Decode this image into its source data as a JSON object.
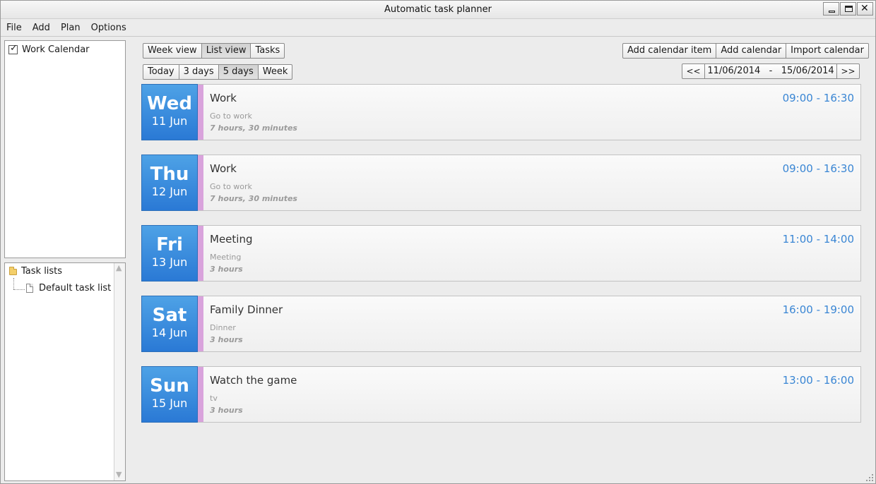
{
  "window": {
    "title": "Automatic task planner"
  },
  "menu": [
    "File",
    "Add",
    "Plan",
    "Options"
  ],
  "calendars": [
    {
      "name": "Work Calendar",
      "checked": true
    }
  ],
  "task_tree": {
    "root": "Task lists",
    "children": [
      "Default task list"
    ]
  },
  "view_tabs": {
    "items": [
      "Week view",
      "List view",
      "Tasks"
    ],
    "selected": "List view"
  },
  "range_tabs": {
    "items": [
      "Today",
      "3 days",
      "5 days",
      "Week"
    ],
    "selected": "5 days"
  },
  "actions": [
    "Add calendar item",
    "Add calendar",
    "Import calendar"
  ],
  "date_range": {
    "prev": "<<",
    "next": ">>",
    "text": "11/06/2014   -   15/06/2014"
  },
  "events": [
    {
      "day": "Wed",
      "date": "11 Jun",
      "title": "Work",
      "description": "Go to work",
      "duration": "7 hours, 30 minutes",
      "time": "09:00 - 16:30"
    },
    {
      "day": "Thu",
      "date": "12 Jun",
      "title": "Work",
      "description": "Go to work",
      "duration": "7 hours, 30 minutes",
      "time": "09:00 - 16:30"
    },
    {
      "day": "Fri",
      "date": "13 Jun",
      "title": "Meeting",
      "description": "Meeting",
      "duration": "3 hours",
      "time": "11:00 - 14:00"
    },
    {
      "day": "Sat",
      "date": "14 Jun",
      "title": "Family Dinner",
      "description": "Dinner",
      "duration": "3 hours",
      "time": "16:00 - 19:00"
    },
    {
      "day": "Sun",
      "date": "15 Jun",
      "title": "Watch the game",
      "description": "tv",
      "duration": "3 hours",
      "time": "13:00 - 16:00"
    }
  ],
  "colors": {
    "day_blue": "#2a79d5",
    "time_blue": "#3a86d4",
    "stripe": "#d9a3dc"
  }
}
